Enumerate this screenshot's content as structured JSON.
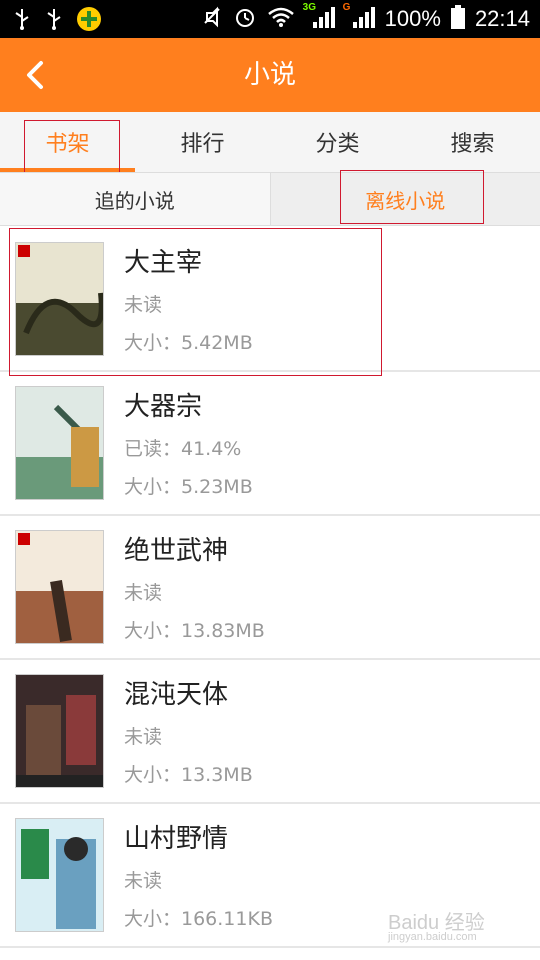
{
  "statusbar": {
    "battery": "100%",
    "time": "22:14",
    "net1": "3G",
    "net2": "G"
  },
  "header": {
    "title": "小说"
  },
  "tabs": [
    {
      "label": "书架",
      "active": true
    },
    {
      "label": "排行",
      "active": false
    },
    {
      "label": "分类",
      "active": false
    },
    {
      "label": "搜索",
      "active": false
    }
  ],
  "subtabs": [
    {
      "label": "追的小说",
      "active": false
    },
    {
      "label": "离线小说",
      "active": true
    }
  ],
  "books": [
    {
      "title": "大主宰",
      "status": "未读",
      "size": "大小：5.42MB",
      "cover_color": "#6a6a4a"
    },
    {
      "title": "大器宗",
      "status": "已读：41.4%",
      "size": "大小：5.23MB",
      "cover_color": "#7aa0a0"
    },
    {
      "title": "绝世武神",
      "status": "未读",
      "size": "大小：13.83MB",
      "cover_color": "#c9a98a"
    },
    {
      "title": "混沌天体",
      "status": "未读",
      "size": "大小：13.3MB",
      "cover_color": "#5a3a3a"
    },
    {
      "title": "山村野情",
      "status": "未读",
      "size": "大小：166.11KB",
      "cover_color": "#6aa0c0"
    }
  ],
  "colors": {
    "accent": "#ff7f1e",
    "highlight": "#d0192f"
  },
  "watermark": {
    "text": "Baidu 经验",
    "sub": "jingyan.baidu.com"
  }
}
